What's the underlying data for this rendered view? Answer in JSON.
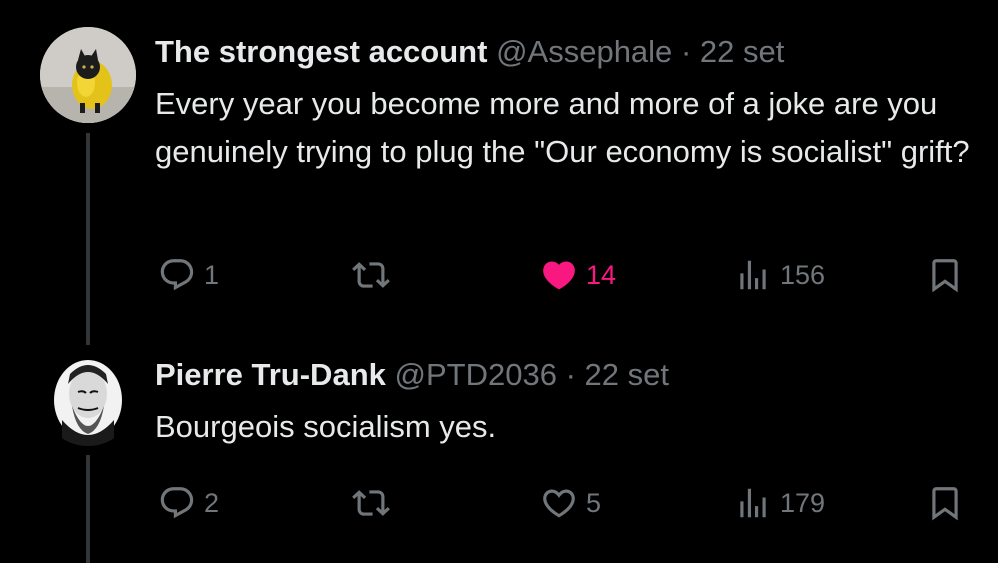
{
  "tweets": [
    {
      "display_name": "The strongest account",
      "handle": "@Assephale",
      "separator": "·",
      "date": "22 set",
      "text": "Every year you become more and more of a joke are you genuinely trying to plug the \"Our economy is socialist\" grift?",
      "replies": "1",
      "likes": "14",
      "liked": true,
      "views": "156",
      "avatar_icon": "cat-in-yellow-raincoat-avatar"
    },
    {
      "display_name": "Pierre Tru-Dank",
      "handle": "@PTD2036",
      "separator": "·",
      "date": "22 set",
      "text": "Bourgeois socialism yes.",
      "replies": "2",
      "likes": "5",
      "liked": false,
      "views": "179",
      "avatar_icon": "bearded-man-engraving-avatar"
    }
  ],
  "colors": {
    "background": "#000000",
    "text": "#e7e9ea",
    "muted": "#71767b",
    "like_active": "#f91880",
    "thread_line": "#333639"
  }
}
